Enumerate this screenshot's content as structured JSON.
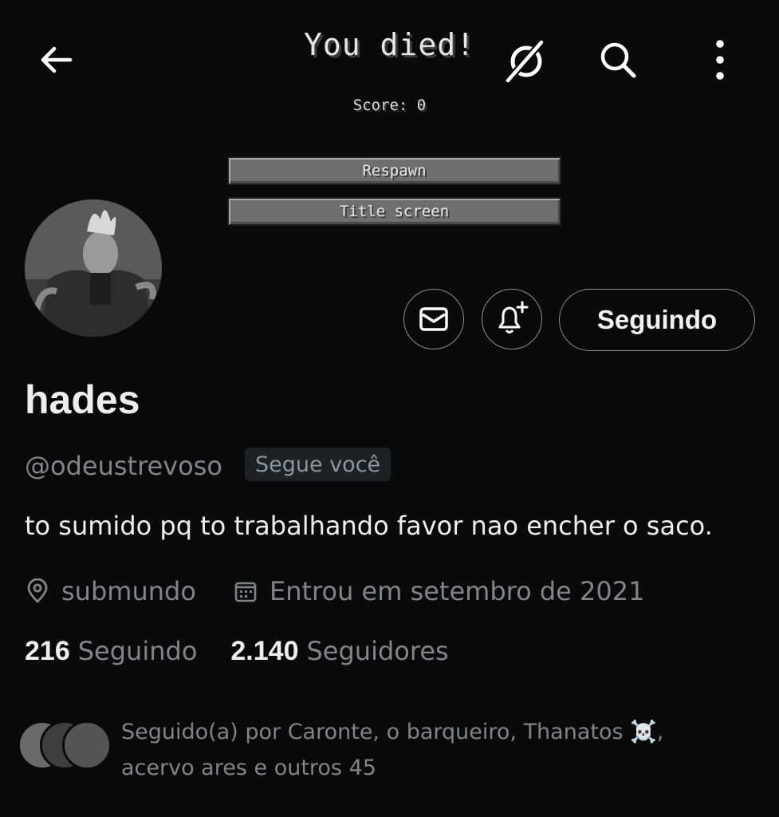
{
  "overlay": {
    "title": "You died!",
    "score": "Score: 0",
    "respawn_label": "Respawn",
    "title_screen_label": "Title screen"
  },
  "topbar": {
    "back_icon": "arrow-left-icon",
    "hide_icon": "eye-slash-icon",
    "search_icon": "search-icon",
    "more_icon": "more-vertical-icon"
  },
  "profile": {
    "name": "hades",
    "handle": "@odeustrevoso",
    "follows_you": "Segue você",
    "bio": "to sumido pq to trabalhando favor nao encher o saco.",
    "location": "submundo",
    "joined": "Entrou em setembro de 2021",
    "following_count": "216",
    "following_label": "Seguindo",
    "followers_count": "2.140",
    "followers_label": "Seguidores",
    "followed_by": "Seguido(a) por Caronte, o barqueiro, Thanatos ☠️, acervo ares e outros 45"
  },
  "actions": {
    "follow_label": "Seguindo",
    "message_icon": "mail-icon",
    "notify_icon": "bell-plus-icon"
  },
  "colors": {
    "background": "#0a0a0a",
    "text_primary": "#e7e9ea",
    "text_secondary": "#7f858a"
  }
}
